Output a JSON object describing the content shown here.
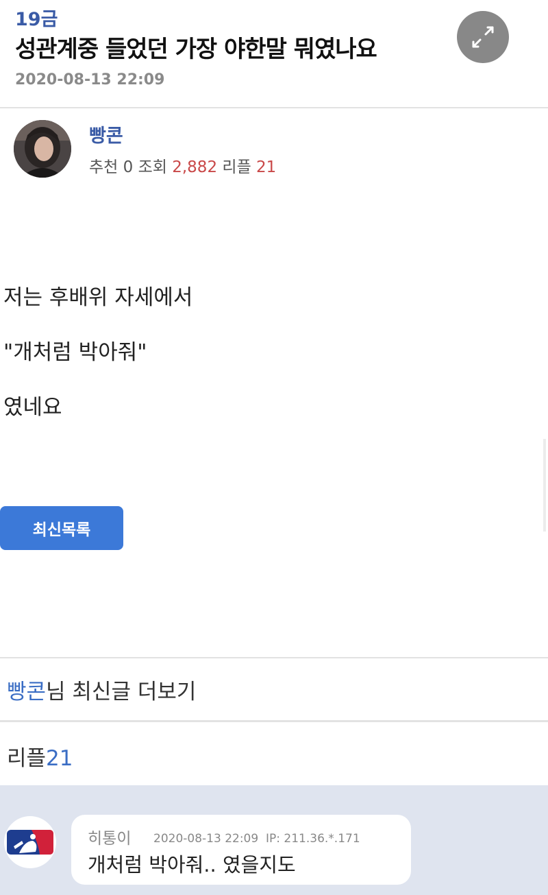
{
  "post": {
    "category": "19금",
    "title": "성관계중 들었던 가장 야한말 뭐였나요",
    "date": "2020-08-13 22:09",
    "author": "빵콘",
    "stats": {
      "recommend_label": "추천",
      "recommend_value": "0",
      "views_label": "조회",
      "views_value": "2,882",
      "replies_label": "리플",
      "replies_value": "21"
    },
    "body": [
      "저는 후배위 자세에서",
      "\"개처럼 박아줘\"",
      "였네요"
    ]
  },
  "buttons": {
    "latest_list": "최신목록"
  },
  "author_more": {
    "author": "빵콘",
    "suffix": "님 최신글 더보기"
  },
  "replies": {
    "label": "리플",
    "count": "21",
    "items": [
      {
        "author": "히통이",
        "date": "2020-08-13 22:09",
        "ip": "IP: 211.36.*.171",
        "text": "개처럼 박아줘.. 였을지도"
      }
    ]
  },
  "icons": {
    "expand": "expand-icon",
    "avatar": "user-avatar",
    "reply_avatar": "mlb-logo-icon"
  },
  "colors": {
    "accent_blue": "#3a5ba6",
    "link_blue": "#3a6dc4",
    "button_blue": "#3c79d8",
    "highlight_red": "#c94848",
    "reply_bg": "#dfe4ef"
  }
}
